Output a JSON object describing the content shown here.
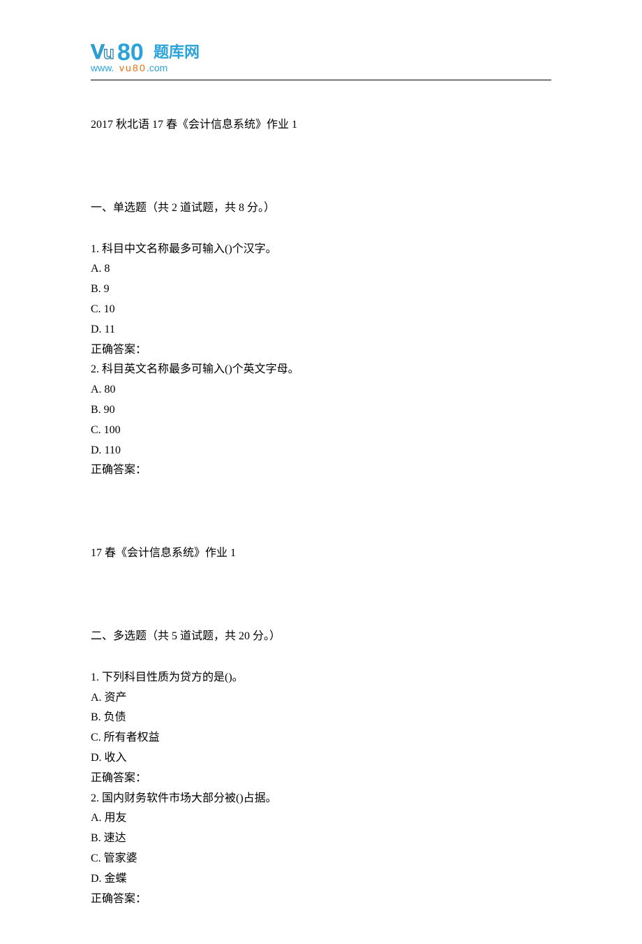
{
  "logo": {
    "text_main": "80",
    "text_suffix": "题库网",
    "url_line": "www.vu80.com"
  },
  "title": "2017 秋北语 17 春《会计信息系统》作业 1",
  "section1": {
    "heading": "一、单选题（共 2 道试题，共 8 分。）",
    "questions": [
      {
        "stem": "1.   科目中文名称最多可输入()个汉字。",
        "options": [
          "A. 8",
          "B. 9",
          "C. 10",
          "D. 11"
        ],
        "answer_label": "正确答案："
      },
      {
        "stem": "2.   科目英文名称最多可输入()个英文字母。",
        "options": [
          "A. 80",
          "B. 90",
          "C. 100",
          "D. 110"
        ],
        "answer_label": "正确答案："
      }
    ]
  },
  "subtitle": "17 春《会计信息系统》作业 1",
  "section2": {
    "heading": "二、多选题（共 5 道试题，共 20 分。）",
    "questions": [
      {
        "stem": "1.   下列科目性质为贷方的是()。",
        "options": [
          "A. 资产",
          "B. 负债",
          "C. 所有者权益",
          "D. 收入"
        ],
        "answer_label": "正确答案："
      },
      {
        "stem": "2.   国内财务软件市场大部分被()占据。",
        "options": [
          "A. 用友",
          "B. 速达",
          "C. 管家婆",
          "D. 金蝶"
        ],
        "answer_label": "正确答案："
      }
    ]
  }
}
